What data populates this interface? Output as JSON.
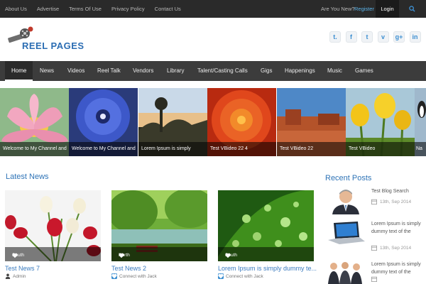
{
  "topbar": {
    "links": [
      "About Us",
      "Advertise",
      "Terms Of Use",
      "Privacy Policy",
      "Contact Us"
    ],
    "ask": "Are You New?",
    "register": "Register",
    "login": "Login",
    "search_icon": "search-icon"
  },
  "header": {
    "logo_text": "REEL PAGES",
    "socials": [
      {
        "icon": "tumblr-icon",
        "glyph": "t."
      },
      {
        "icon": "facebook-icon",
        "glyph": "f"
      },
      {
        "icon": "twitter-icon",
        "glyph": "t"
      },
      {
        "icon": "vimeo-icon",
        "glyph": "v"
      },
      {
        "icon": "google-plus-icon",
        "glyph": "g+"
      },
      {
        "icon": "linkedin-icon",
        "glyph": "in"
      }
    ]
  },
  "nav": {
    "items": [
      "Home",
      "News",
      "Videos",
      "Reel Talk",
      "Vendors",
      "Library",
      "Talent/Casting Calls",
      "Gigs",
      "Happenings",
      "Music",
      "Games"
    ],
    "active": "Home"
  },
  "slider": {
    "slides": [
      {
        "caption": "Welcome to My Channel and"
      },
      {
        "caption": "Welcome to My Channel and"
      },
      {
        "caption": "Lorem Ipsum is simply"
      },
      {
        "caption": "Test VBideo 22 4"
      },
      {
        "caption": "Test VBideo 22"
      },
      {
        "caption": "Test VBideo"
      },
      {
        "caption": "Na"
      }
    ]
  },
  "latest": {
    "title": "Latest News",
    "cards": [
      {
        "tag": "South",
        "title": "Test News 7",
        "meta": "Admin"
      },
      {
        "tag": "North",
        "title": "Test News 2",
        "meta": "Connect with  Jack"
      },
      {
        "tag": "South",
        "title": "Lorem Ipsum is simply dummy te...",
        "meta": "Connect with  Jack"
      }
    ]
  },
  "recent": {
    "title": "Recent Posts",
    "posts": [
      {
        "title": "Test Blog Search",
        "date": "13th, Sep 2014"
      },
      {
        "title": "Lorem Ipsum is simply dummy text of the",
        "date": "13th, Sep 2014"
      },
      {
        "title": "Lorem Ipsum is simply dummy text of the",
        "date": ""
      }
    ]
  },
  "colors": {
    "topbar": "#2a2a2a",
    "nav": "#3c3c3c",
    "accent_blue": "#2f74b7",
    "register_link": "#5ab2e8"
  }
}
